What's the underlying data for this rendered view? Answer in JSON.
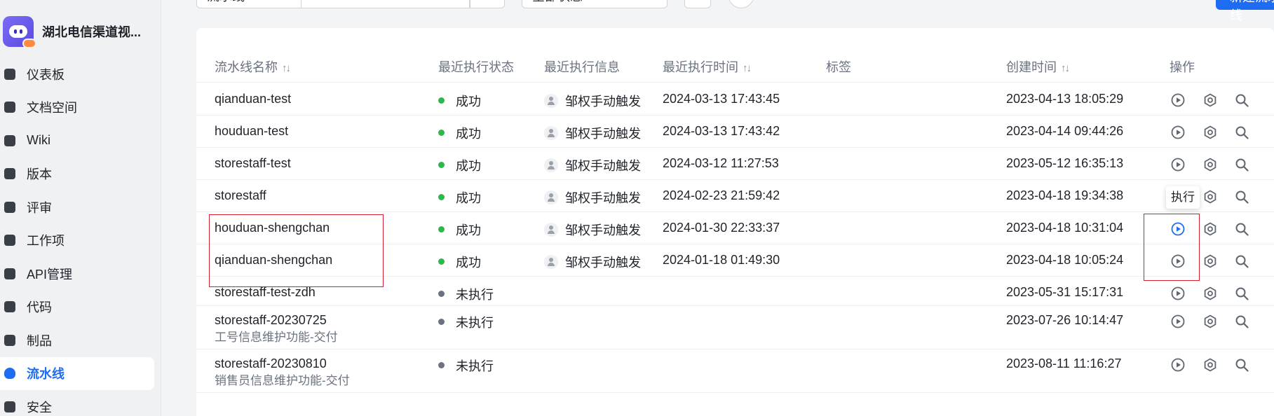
{
  "app": {
    "name": "湖北电信渠道视..."
  },
  "sidebar": {
    "items": [
      {
        "label": "仪表板",
        "icon": "dashboard-icon",
        "active": false
      },
      {
        "label": "文档空间",
        "icon": "document-icon",
        "active": false
      },
      {
        "label": "Wiki",
        "icon": "wiki-icon",
        "active": false
      },
      {
        "label": "版本",
        "icon": "version-icon",
        "active": false
      },
      {
        "label": "评审",
        "icon": "review-icon",
        "active": false
      },
      {
        "label": "工作项",
        "icon": "checkbox-icon",
        "active": false
      },
      {
        "label": "API管理",
        "icon": "share-icon",
        "active": false
      },
      {
        "label": "代码",
        "icon": "code-icon",
        "active": false
      },
      {
        "label": "制品",
        "icon": "artifact-icon",
        "active": false
      },
      {
        "label": "流水线",
        "icon": "pipeline-icon",
        "active": true
      },
      {
        "label": "安全",
        "icon": "shield-icon",
        "active": false
      }
    ]
  },
  "toolbar": {
    "filter_value": "流水线",
    "status_value": "全部状态",
    "create_label": "新建流水线"
  },
  "table": {
    "headers": {
      "name": "流水线名称",
      "status": "最近执行状态",
      "info": "最近执行信息",
      "last_time": "最近执行时间",
      "tags": "标签",
      "created": "创建时间",
      "actions": "操作"
    },
    "rows": [
      {
        "name": "qianduan-test",
        "desc": "",
        "status": "成功",
        "status_type": "ok",
        "trigger": "邹权手动触发",
        "last_time": "2024-03-13 17:43:45",
        "created": "2023-04-13 18:05:29"
      },
      {
        "name": "houduan-test",
        "desc": "",
        "status": "成功",
        "status_type": "ok",
        "trigger": "邹权手动触发",
        "last_time": "2024-03-13 17:43:42",
        "created": "2023-04-14 09:44:26"
      },
      {
        "name": "storestaff-test",
        "desc": "",
        "status": "成功",
        "status_type": "ok",
        "trigger": "邹权手动触发",
        "last_time": "2024-03-12 11:27:53",
        "created": "2023-05-12 16:35:13"
      },
      {
        "name": "storestaff",
        "desc": "",
        "status": "成功",
        "status_type": "ok",
        "trigger": "邹权手动触发",
        "last_time": "2024-02-23 21:59:42",
        "created": "2023-04-18 19:34:38"
      },
      {
        "name": "houduan-shengchan",
        "desc": "",
        "status": "成功",
        "status_type": "ok",
        "trigger": "邹权手动触发",
        "last_time": "2024-01-30 22:33:37",
        "created": "2023-04-18 10:31:04"
      },
      {
        "name": "qianduan-shengchan",
        "desc": "",
        "status": "成功",
        "status_type": "ok",
        "trigger": "邹权手动触发",
        "last_time": "2024-01-18 01:49:30",
        "created": "2023-04-18 10:05:24"
      },
      {
        "name": "storestaff-test-zdh",
        "desc": "",
        "status": "未执行",
        "status_type": "none",
        "trigger": "",
        "last_time": "",
        "created": "2023-05-31 15:17:31"
      },
      {
        "name": "storestaff-20230725",
        "desc": "工号信息维护功能-交付",
        "status": "未执行",
        "status_type": "none",
        "trigger": "",
        "last_time": "",
        "created": "2023-07-26 10:14:47"
      },
      {
        "name": "storestaff-20230810",
        "desc": "销售员信息维护功能-交付",
        "status": "未执行",
        "status_type": "none",
        "trigger": "",
        "last_time": "",
        "created": "2023-08-11 11:16:27"
      }
    ]
  },
  "tooltip": {
    "text": "执行"
  },
  "colors": {
    "accent": "#1e6cf2",
    "success": "#2db84d",
    "muted": "#6b7280",
    "highlight": "#d81e2c"
  }
}
